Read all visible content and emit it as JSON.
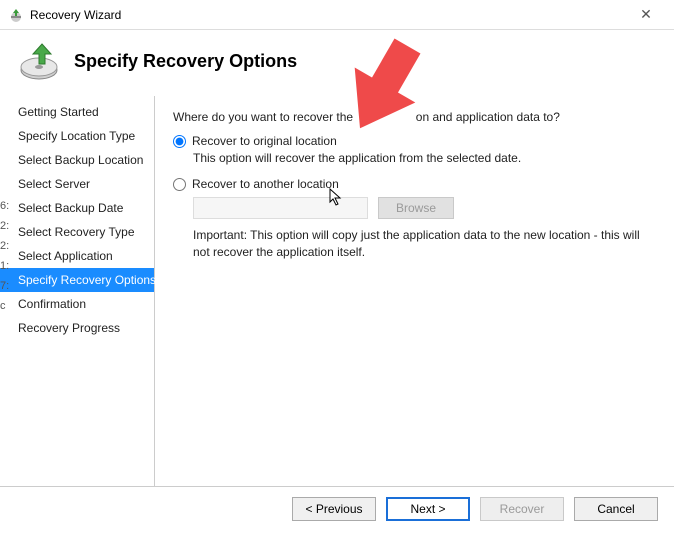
{
  "window": {
    "title": "Recovery Wizard",
    "close": "✕"
  },
  "header": {
    "title": "Specify Recovery Options"
  },
  "sidebar": {
    "items": [
      {
        "label": "Getting Started"
      },
      {
        "label": "Specify Location Type"
      },
      {
        "label": "Select Backup Location"
      },
      {
        "label": "Select Server"
      },
      {
        "label": "Select Backup Date"
      },
      {
        "label": "Select Recovery Type"
      },
      {
        "label": "Select Application"
      },
      {
        "label": "Specify Recovery Options"
      },
      {
        "label": "Confirmation"
      },
      {
        "label": "Recovery Progress"
      }
    ],
    "activeIndex": 7
  },
  "content": {
    "question_pre": "Where do you want to recover the",
    "question_post": "on and application data to?",
    "option1": {
      "label": "Recover to original location",
      "desc": "This option will recover the application from the selected date."
    },
    "option2": {
      "label": "Recover to another location",
      "path_value": "",
      "browse_label": "Browse",
      "important": "Important: This option will copy just the application data to the new location - this will not recover the application itself."
    }
  },
  "footer": {
    "previous": "< Previous",
    "next": "Next >",
    "recover": "Recover",
    "cancel": "Cancel"
  },
  "leftstubs": [
    "6:",
    "2:",
    " ",
    "2:",
    "1:",
    "7:",
    " ",
    " ",
    " ",
    " ",
    " ",
    " ",
    " ",
    "c"
  ]
}
